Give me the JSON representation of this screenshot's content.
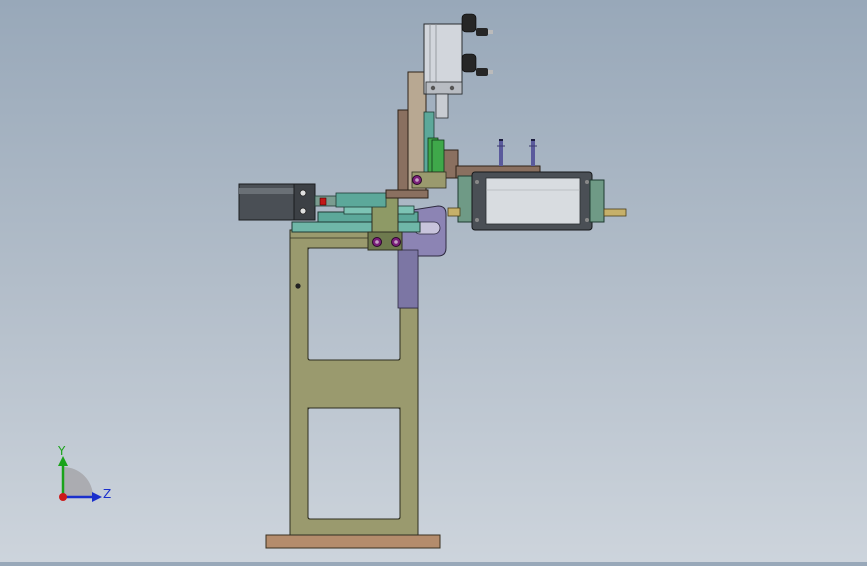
{
  "viewport": {
    "background_top": "#98a8b9",
    "background_bottom": "#cdd4dc"
  },
  "triad": {
    "y_label": "Y",
    "z_label": "Z",
    "y_color": "#1aa31a",
    "z_color": "#1a2fcc",
    "x_color": "#cc1a1a"
  },
  "model": {
    "frame_color": "#9a9a6e",
    "base_color": "#b48c6c",
    "bracket_color": "#8a7060",
    "cylinder_color": "#d2d6dc",
    "motor_body_color": "#4a4f55",
    "motor_end_color": "#6f9a86",
    "slide_color": "#5ca89a",
    "fitting_color": "#262626",
    "bolt_color": "#5a5a9c",
    "purple_plate_color": "#8c84b4"
  }
}
